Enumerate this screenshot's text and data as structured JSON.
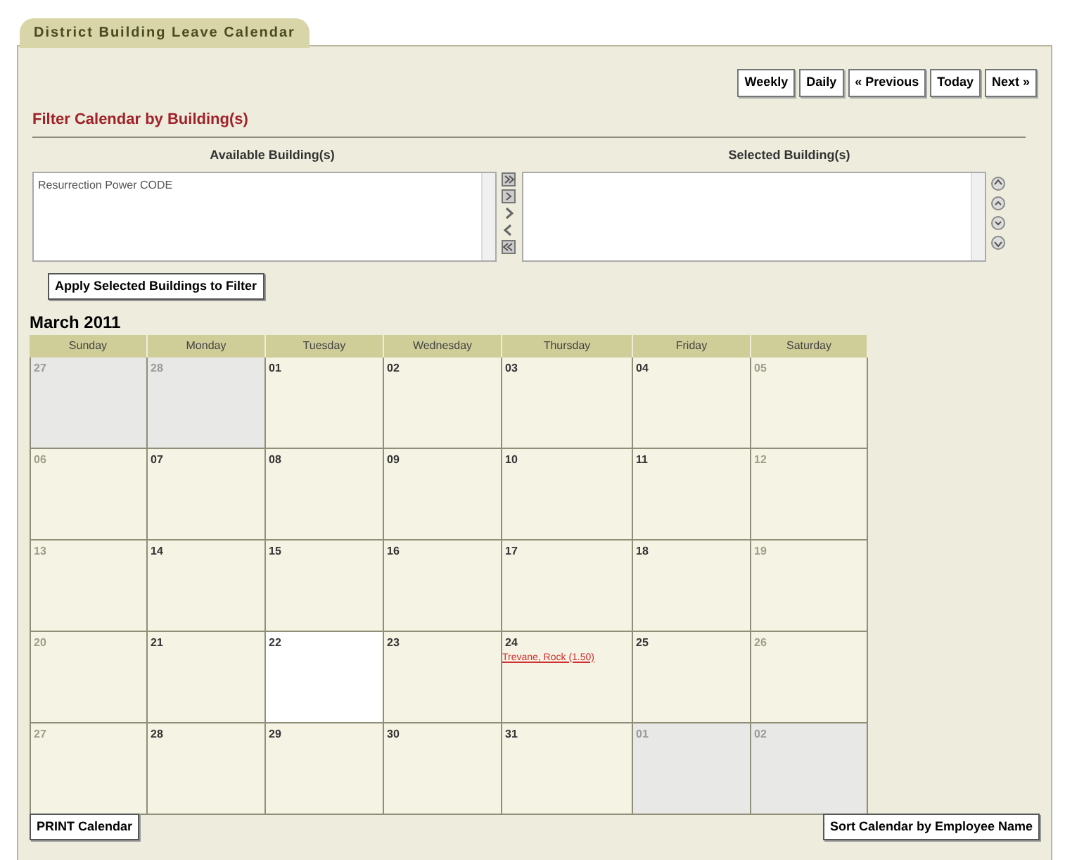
{
  "window": {
    "title": "District Building Leave Calendar"
  },
  "nav_buttons": [
    "Weekly",
    "Daily",
    "« Previous",
    "Today",
    "Next »"
  ],
  "filter": {
    "heading": "Filter Calendar by Building(s)",
    "available_label": "Available Building(s)",
    "selected_label": "Selected Building(s)",
    "available_items": [
      "Resurrection Power CODE"
    ],
    "apply_button": "Apply Selected Buildings to Filter"
  },
  "calendar": {
    "month": "March 2011",
    "weekdays": [
      "Sunday",
      "Monday",
      "Tuesday",
      "Wednesday",
      "Thursday",
      "Friday",
      "Saturday"
    ],
    "weeks": [
      [
        {
          "day": "27",
          "kind": "outside",
          "selected": false
        },
        {
          "day": "28",
          "kind": "outside",
          "selected": false
        },
        {
          "day": "01",
          "kind": "weekday",
          "selected": false
        },
        {
          "day": "02",
          "kind": "weekday",
          "selected": false
        },
        {
          "day": "03",
          "kind": "weekday",
          "selected": false
        },
        {
          "day": "04",
          "kind": "weekday",
          "selected": false
        },
        {
          "day": "05",
          "kind": "weekend",
          "selected": false
        }
      ],
      [
        {
          "day": "06",
          "kind": "weekend",
          "selected": false
        },
        {
          "day": "07",
          "kind": "weekday",
          "selected": false
        },
        {
          "day": "08",
          "kind": "weekday",
          "selected": false
        },
        {
          "day": "09",
          "kind": "weekday",
          "selected": false
        },
        {
          "day": "10",
          "kind": "weekday",
          "selected": false
        },
        {
          "day": "11",
          "kind": "weekday",
          "selected": false
        },
        {
          "day": "12",
          "kind": "weekend",
          "selected": false
        }
      ],
      [
        {
          "day": "13",
          "kind": "weekend",
          "selected": false
        },
        {
          "day": "14",
          "kind": "weekday",
          "selected": false
        },
        {
          "day": "15",
          "kind": "weekday",
          "selected": false
        },
        {
          "day": "16",
          "kind": "weekday",
          "selected": false
        },
        {
          "day": "17",
          "kind": "weekday",
          "selected": false
        },
        {
          "day": "18",
          "kind": "weekday",
          "selected": false
        },
        {
          "day": "19",
          "kind": "weekend",
          "selected": false
        }
      ],
      [
        {
          "day": "20",
          "kind": "weekend",
          "selected": false
        },
        {
          "day": "21",
          "kind": "weekday",
          "selected": false
        },
        {
          "day": "22",
          "kind": "weekday",
          "selected": true
        },
        {
          "day": "23",
          "kind": "weekday",
          "selected": false
        },
        {
          "day": "24",
          "kind": "weekday",
          "selected": false,
          "events": [
            "Trevane, Rock (1.50)"
          ]
        },
        {
          "day": "25",
          "kind": "weekday",
          "selected": false
        },
        {
          "day": "26",
          "kind": "weekend",
          "selected": false
        }
      ],
      [
        {
          "day": "27",
          "kind": "weekend",
          "selected": false
        },
        {
          "day": "28",
          "kind": "weekday",
          "selected": false
        },
        {
          "day": "29",
          "kind": "weekday",
          "selected": false
        },
        {
          "day": "30",
          "kind": "weekday",
          "selected": false
        },
        {
          "day": "31",
          "kind": "weekday",
          "selected": false
        },
        {
          "day": "01",
          "kind": "outside",
          "selected": false
        },
        {
          "day": "02",
          "kind": "outside",
          "selected": false
        }
      ]
    ]
  },
  "footer_buttons": [
    "PRINT Calendar",
    "Sort Calendar by Employee Name"
  ]
}
